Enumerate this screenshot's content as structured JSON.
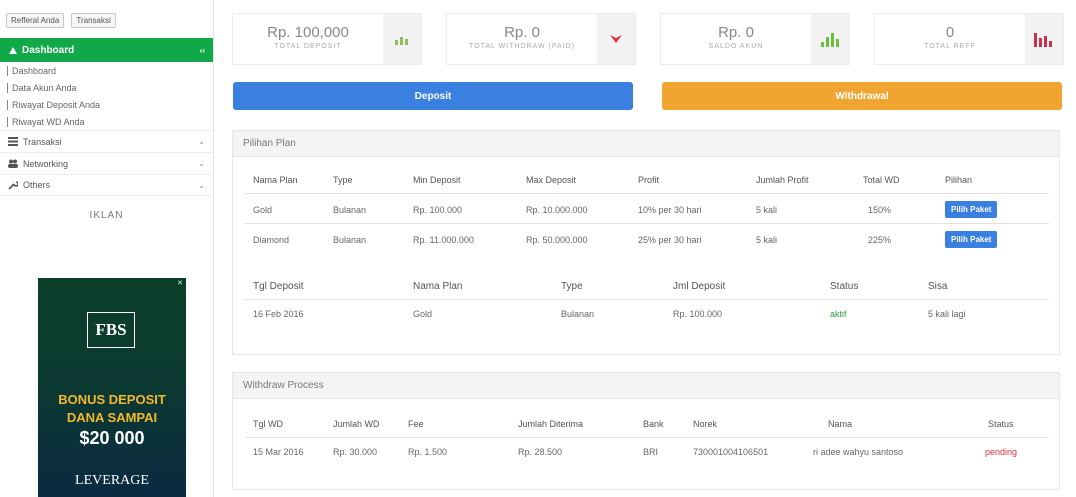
{
  "sidebar": {
    "top_buttons": [
      "Refferal Anda",
      "Transaksi"
    ],
    "active_item": "Dashboard",
    "active_chevron": "‹‹",
    "subitems": [
      "Dashboard",
      "Data Akun Anda",
      "Riwayat Deposit Anda",
      "Riwayat WD Anda"
    ],
    "items": [
      {
        "icon": "list-icon",
        "label": "Transaksi"
      },
      {
        "icon": "users-icon",
        "label": "Networking"
      },
      {
        "icon": "wrench-icon",
        "label": "Others"
      }
    ],
    "iklan_title": "IKLAN"
  },
  "ad": {
    "close": "✕",
    "logo": "FBS",
    "line1": "BONUS DEPOSIT",
    "line2": "DANA SAMPAI",
    "line3": "$20 000",
    "line4": "LEVERAGE"
  },
  "cards": [
    {
      "value": "Rp. 100,000",
      "label": "TOTAL DEPOSIT",
      "icon": "bar-chart-icon",
      "color": "#8fbf5a"
    },
    {
      "value": "Rp. 0",
      "label": "TOTAL WITHDRAW (PAID)",
      "icon": "down-arrow-icon",
      "color": "#d9343a"
    },
    {
      "value": "Rp. 0",
      "label": "SALDO AKUN",
      "icon": "bar-chart-icon",
      "color": "#6cbf3a"
    },
    {
      "value": "0",
      "label": "TOTAL REFF",
      "icon": "bar-chart-icon",
      "color": "#c8324a"
    }
  ],
  "actions": {
    "deposit": "Deposit",
    "withdrawal": "Withdrawal"
  },
  "plans": {
    "title": "Pilihan Plan",
    "headers": [
      "Nama Plan",
      "Type",
      "Min Deposit",
      "Max Deposit",
      "Profit",
      "Jumlah Profit",
      "Total WD",
      "Pilihan"
    ],
    "rows": [
      [
        "Gold",
        "Bulanan",
        "Rp. 100.000",
        "Rp. 10.000.000",
        "10% per 30 hari",
        "5 kali",
        "150%",
        "Pilih Paket"
      ],
      [
        "Diamond",
        "Bulanan",
        "Rp. 11.000.000",
        "Rp. 50.000.000",
        "25% per 30 hari",
        "5 kali",
        "225%",
        "Pilih Paket"
      ]
    ]
  },
  "deposits": {
    "headers": [
      "Tgl Deposit",
      "Nama Plan",
      "Type",
      "Jml Deposit",
      "Status",
      "Sisa"
    ],
    "rows": [
      [
        "16 Feb 2016",
        "Gold",
        "Bulanan",
        "Rp. 100.000",
        "aktif",
        "5 kali lagi"
      ]
    ]
  },
  "withdraw": {
    "title": "Withdraw Process",
    "headers": [
      "Tgl WD",
      "Jumlah WD",
      "Fee",
      "Jumlah Diterima",
      "Bank",
      "Norek",
      "Nama",
      "Status"
    ],
    "rows": [
      [
        "15 Mar 2016",
        "Rp. 30.000",
        "Rp. 1.500",
        "Rp. 28.500",
        "BRI",
        "730001004106501",
        "ri adee wahyu santoso",
        "pending"
      ]
    ]
  },
  "colors": {
    "green": "#11a84a",
    "blue": "#3a80e0",
    "orange": "#f1a531",
    "status_active": "#2e9e3e",
    "status_pending": "#d9343a"
  }
}
